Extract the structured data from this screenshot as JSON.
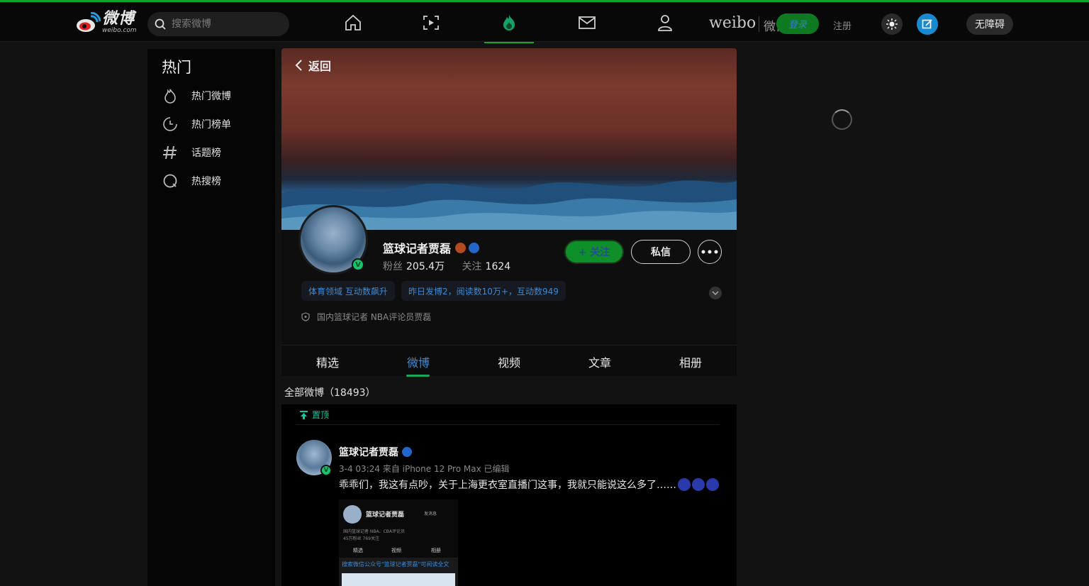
{
  "header": {
    "logo_cn": "微博",
    "logo_en": "weibo.com",
    "search_placeholder": "搜索微博",
    "brand_en": "weibo",
    "brand_cn": "微博",
    "login_label": "登录",
    "register_label": "注册",
    "accessibility_label": "无障碍",
    "nav": [
      "home-icon",
      "video-icon",
      "hot-icon",
      "message-icon",
      "profile-icon"
    ],
    "accent": "#0fa52f"
  },
  "sidebar": {
    "title": "热门",
    "items": [
      {
        "label": "热门微博",
        "icon": "flame-icon"
      },
      {
        "label": "热门榜单",
        "icon": "clock-chart-icon"
      },
      {
        "label": "话题榜",
        "icon": "hash-icon"
      },
      {
        "label": "热搜榜",
        "icon": "search-ring-icon"
      }
    ]
  },
  "profile": {
    "back_label": "返回",
    "name": "篮球记者贾磊",
    "fans_label": "粉丝",
    "fans_value": "205.4万",
    "following_label": "关注",
    "following_value": "1624",
    "follow_button": "+ 关注",
    "dm_button": "私信",
    "tags": [
      "体育领域 互动数飙升",
      "昨日发博2，阅读数10万+，互动数949"
    ],
    "bio": "国内篮球记者 NBA评论员贾磊",
    "verified_mark": "V"
  },
  "tabs": [
    {
      "label": "精选"
    },
    {
      "label": "微博",
      "active": true
    },
    {
      "label": "视频"
    },
    {
      "label": "文章"
    },
    {
      "label": "相册"
    }
  ],
  "feed": {
    "count_label": "全部微博（18493）",
    "pinned_label": "置顶",
    "post": {
      "author": "篮球记者贾磊",
      "meta": "3-4 03:24 来自 iPhone 12 Pro Max 已编辑",
      "text": "乖乖们，我这有点吵，关于上海更衣室直播门这事，我就只能说这么多了……",
      "image": {
        "name": "篮球记者贾磊",
        "line1": "国内篮球记者 NBA、CBA评论员",
        "line2": "45万粉丝  769关注",
        "tabs": [
          "精选",
          "视频",
          "相册"
        ],
        "banner": "搜索微信公众号\"篮球记者贾磊\"可阅读全文",
        "button": "发消息"
      }
    }
  }
}
